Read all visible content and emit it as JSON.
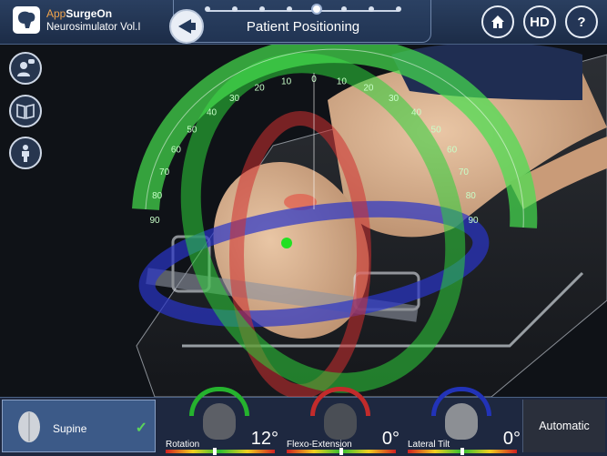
{
  "app": {
    "brand_prefix": "App",
    "brand_suffix": "SurgeOn",
    "product": "Neurosimulator Vol.I"
  },
  "header": {
    "title": "Patient Positioning",
    "hd_label": "HD",
    "help_label": "?",
    "current_step": 4,
    "total_steps": 8
  },
  "protractor": {
    "left_ticks": [
      "10",
      "20",
      "30",
      "40",
      "50",
      "60",
      "70",
      "80",
      "90"
    ],
    "right_ticks": [
      "10",
      "20",
      "30",
      "40",
      "50",
      "60",
      "70",
      "80",
      "90"
    ],
    "zero": "0"
  },
  "bottom": {
    "position_label": "Supine",
    "position_check": "✓",
    "automatic_label": "Automatic",
    "controls": [
      {
        "label": "Rotation",
        "value": "12°",
        "level": 0.45,
        "arc_color": "#25b32e"
      },
      {
        "label": "Flexo-Extension",
        "value": "0°",
        "level": 0.5,
        "arc_color": "#c22b2b"
      },
      {
        "label": "Lateral Tilt",
        "value": "0°",
        "level": 0.5,
        "arc_color": "#2233b8"
      }
    ]
  }
}
